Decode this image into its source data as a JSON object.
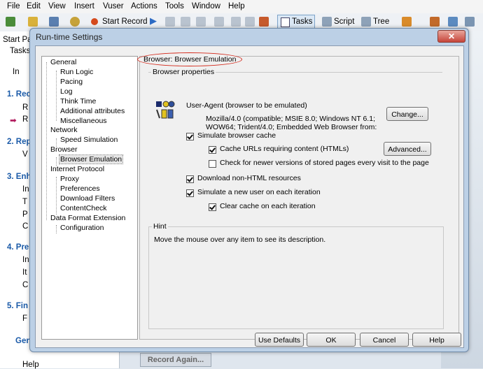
{
  "menubar": [
    "File",
    "Edit",
    "View",
    "Insert",
    "Vuser",
    "Actions",
    "Tools",
    "Window",
    "Help"
  ],
  "toolbar": {
    "start_record": "Start Record",
    "tasks": "Tasks",
    "script": "Script",
    "tree": "Tree"
  },
  "background": {
    "start_page_tab": "Start Pa",
    "tasks_label": "Tasks",
    "items": [
      "In",
      "1. Rec",
      "R",
      "R",
      "2. Rep",
      "V",
      "3. Enh",
      "In",
      "T",
      "P",
      "C",
      "4. Pre",
      "In",
      "It",
      "C",
      "5. Fin",
      "F",
      "Gen",
      "Help"
    ],
    "record_again": "Record Again..."
  },
  "dialog": {
    "title": "Run-time Settings",
    "close": "✕",
    "tree": [
      {
        "label": "General",
        "level": 0
      },
      {
        "label": "Run Logic",
        "level": 1
      },
      {
        "label": "Pacing",
        "level": 1
      },
      {
        "label": "Log",
        "level": 1
      },
      {
        "label": "Think Time",
        "level": 1
      },
      {
        "label": "Additional attributes",
        "level": 1
      },
      {
        "label": "Miscellaneous",
        "level": 1
      },
      {
        "label": "Network",
        "level": 0
      },
      {
        "label": "Speed Simulation",
        "level": 1
      },
      {
        "label": "Browser",
        "level": 0
      },
      {
        "label": "Browser Emulation",
        "level": 1,
        "selected": true
      },
      {
        "label": "Internet Protocol",
        "level": 0
      },
      {
        "label": "Proxy",
        "level": 1
      },
      {
        "label": "Preferences",
        "level": 1
      },
      {
        "label": "Download Filters",
        "level": 1
      },
      {
        "label": "ContentCheck",
        "level": 1
      },
      {
        "label": "Data Format Extension",
        "level": 0
      },
      {
        "label": "Configuration",
        "level": 1
      }
    ],
    "panel": {
      "heading": "Browser: Browser Emulation",
      "browser_properties": "Browser properties",
      "user_agent_label": "User-Agent (browser to be emulated)",
      "user_agent_lines": [
        "Mozilla/4.0 (compatible; MSIE 8.0; Windows NT 6.1;",
        "WOW64; Trident/4.0;  Embedded Web Browser from:"
      ],
      "change_button": "Change...",
      "simulate_cache": {
        "label": "Simulate browser cache",
        "checked": true
      },
      "cache_urls": {
        "label": "Cache URLs requiring content (HTMLs)",
        "checked": true
      },
      "advanced_button": "Advanced...",
      "check_newer": {
        "label": "Check for newer versions of stored pages every visit to the page",
        "checked": false
      },
      "download_nonhtml": {
        "label": "Download non-HTML resources",
        "checked": true
      },
      "simulate_new_user": {
        "label": "Simulate a new user on each iteration",
        "checked": true
      },
      "clear_cache": {
        "label": "Clear cache on each iteration",
        "checked": true
      },
      "hint_title": "Hint",
      "hint_text": "Move the mouse over any item to see its description."
    },
    "buttons": {
      "use_defaults": "Use Defaults",
      "ok": "OK",
      "cancel": "Cancel",
      "help": "Help"
    }
  }
}
